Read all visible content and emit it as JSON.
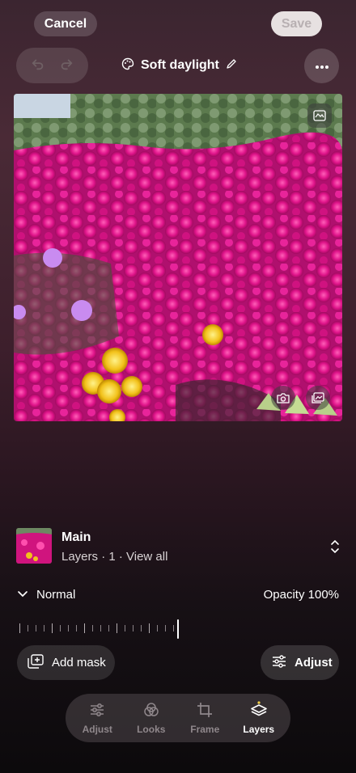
{
  "header": {
    "cancel_label": "Cancel",
    "save_label": "Save",
    "look_title": "Soft daylight"
  },
  "icons": {
    "undo": "undo-icon",
    "redo": "redo-icon",
    "palette": "palette-icon",
    "edit": "pencil-icon",
    "more": "more-icon",
    "compare": "compare-icon",
    "camera": "camera-icon",
    "gallery": "gallery-icon"
  },
  "layer": {
    "name": "Main",
    "subtitle": "Layers · 1 · View all"
  },
  "blend": {
    "mode": "Normal",
    "opacity_label": "Opacity 100%",
    "opacity_value": 1.0
  },
  "actions": {
    "add_mask_label": "Add mask",
    "adjust_label": "Adjust"
  },
  "nav": {
    "items": [
      {
        "label": "Adjust",
        "active": false
      },
      {
        "label": "Looks",
        "active": false
      },
      {
        "label": "Frame",
        "active": false
      },
      {
        "label": "Layers",
        "active": true
      }
    ]
  },
  "colors": {
    "active_accent": "#f5d24a",
    "flower_magenta": "#e0148a"
  }
}
